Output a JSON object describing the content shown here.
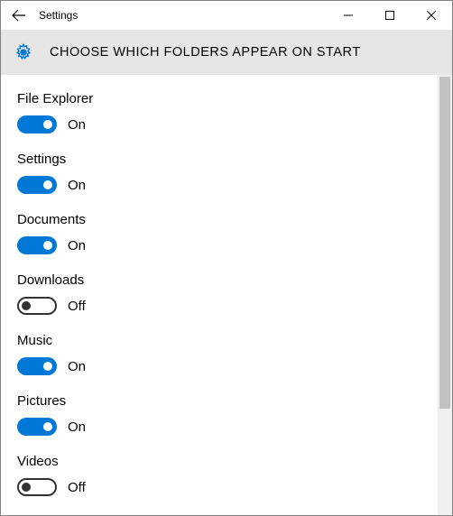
{
  "window": {
    "title": "Settings"
  },
  "header": {
    "title": "CHOOSE WHICH FOLDERS APPEAR ON START"
  },
  "state_labels": {
    "on": "On",
    "off": "Off"
  },
  "options": [
    {
      "label": "File Explorer",
      "on": true
    },
    {
      "label": "Settings",
      "on": true
    },
    {
      "label": "Documents",
      "on": true
    },
    {
      "label": "Downloads",
      "on": false
    },
    {
      "label": "Music",
      "on": true
    },
    {
      "label": "Pictures",
      "on": true
    },
    {
      "label": "Videos",
      "on": false
    }
  ],
  "scrollbar": {
    "thumb_top_pct": 0,
    "thumb_height_pct": 76
  }
}
